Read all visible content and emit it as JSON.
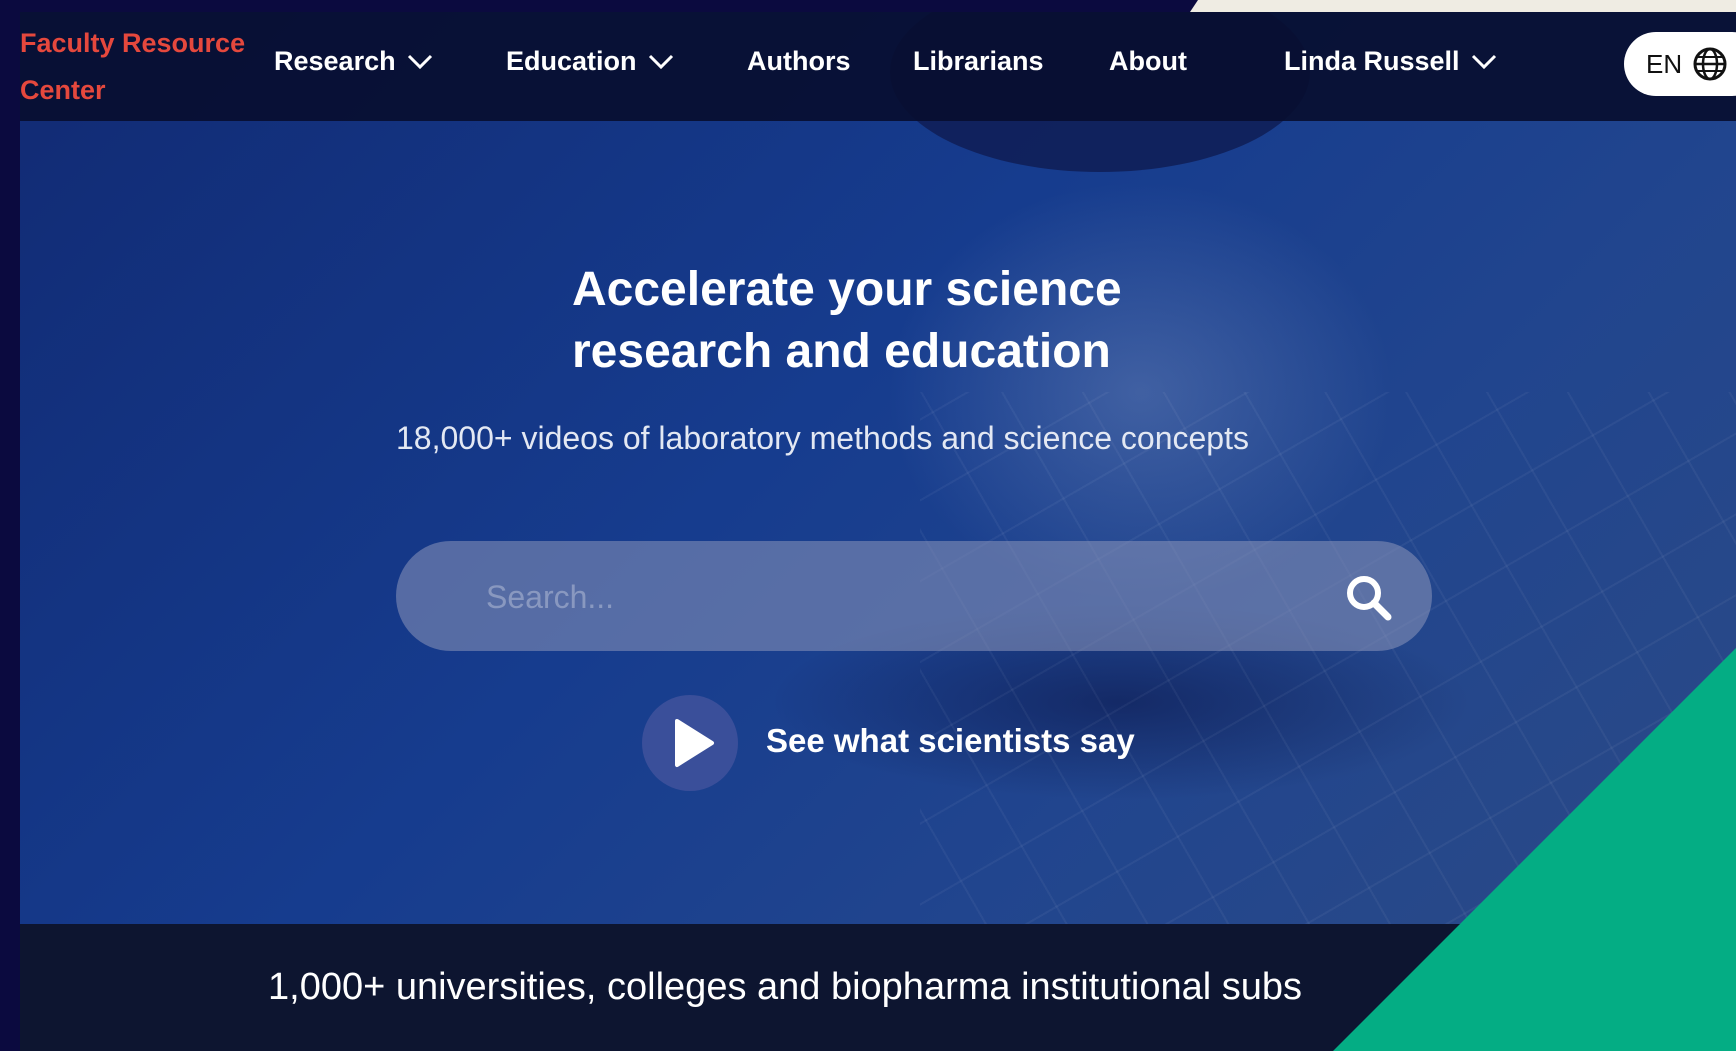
{
  "nav": {
    "brand": "Faculty Resource Center",
    "items": [
      {
        "label": "Research",
        "has_dropdown": true
      },
      {
        "label": "Education",
        "has_dropdown": true
      },
      {
        "label": "Authors",
        "has_dropdown": false
      },
      {
        "label": "Librarians",
        "has_dropdown": false
      },
      {
        "label": "About",
        "has_dropdown": false
      }
    ],
    "user": {
      "name": "Linda Russell"
    },
    "language": {
      "code": "EN",
      "icon": "globe-icon"
    }
  },
  "hero": {
    "headline_line1": "Accelerate your science",
    "headline_line2": "research and education",
    "subtitle": "18,000+ videos of laboratory methods and science concepts",
    "search": {
      "placeholder": "Search...",
      "icon": "search-icon"
    },
    "video_cta": {
      "label": "See what scientists say",
      "icon": "play-icon"
    }
  },
  "footer_bar": {
    "text": "1,000+ universities, colleges and biopharma institutional subs"
  },
  "colors": {
    "brand_red": "#e5483d",
    "nav_bg": "#080e30",
    "hero_blue": "#163c8e",
    "accent_green": "#04ad84"
  }
}
